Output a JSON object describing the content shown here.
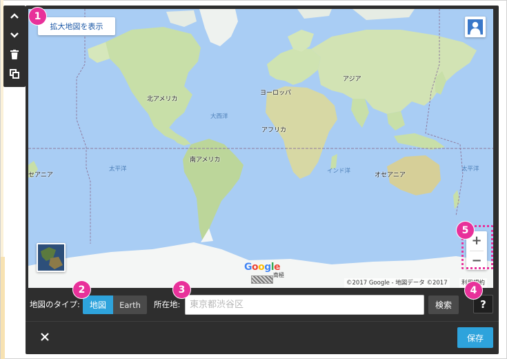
{
  "map": {
    "enlarge_button": "拡大地図を表示",
    "labels": {
      "north_america": "北アメリカ",
      "south_america": "南アメリカ",
      "europe": "ヨーロッパ",
      "africa": "アフリカ",
      "asia": "アジア",
      "oceania_right": "オセアニア",
      "oceania_left": "セアニア",
      "atlantic": "大西洋",
      "pacific_left": "太平洋",
      "pacific_right": "太平洋",
      "indian": "インド洋"
    },
    "google_logo": [
      "G",
      "o",
      "o",
      "g",
      "l",
      "e"
    ],
    "google_logo_colors": [
      "#4285f4",
      "#ea4335",
      "#fbbc05",
      "#4285f4",
      "#34a853",
      "#ea4335"
    ],
    "logo_extra": "南極",
    "attribution": "©2017 Google - 地図データ ©2017",
    "terms": "利用規約",
    "zoom_in": "+",
    "zoom_out": "−"
  },
  "controls": {
    "map_type_label": "地図のタイプ:",
    "map_type_options": [
      "地図",
      "Earth"
    ],
    "map_type_selected": "地図",
    "location_label": "所在地:",
    "location_placeholder": "東京都渋谷区",
    "location_value": "",
    "search_button": "検索",
    "help_button": "?",
    "save_button": "保存"
  },
  "callouts": [
    "1",
    "2",
    "3",
    "4",
    "5"
  ],
  "colors": {
    "accent_blue": "#2ea3dc",
    "callout_pink": "#e8319a",
    "panel_dark": "#2e2e2e",
    "ocean": "#a9cdf4",
    "land": "#c8dfa8"
  },
  "icons": [
    "chevron-up-icon",
    "chevron-down-icon",
    "trash-icon",
    "duplicate-icon",
    "pegman-icon",
    "close-icon"
  ]
}
